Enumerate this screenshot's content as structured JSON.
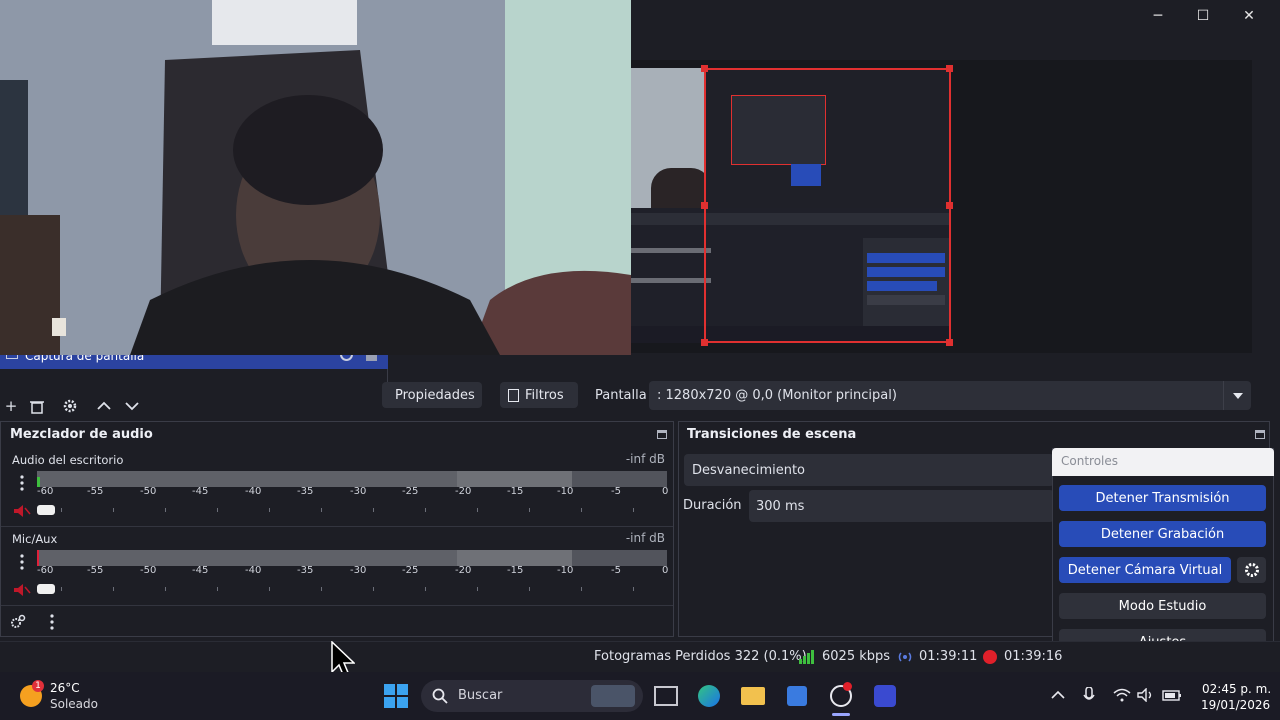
{
  "window": {
    "minimize_glyph": "─",
    "maximize_glyph": "☐",
    "close_glyph": "✕"
  },
  "sources": {
    "selected_item": "Captura de pantalla"
  },
  "properties_bar": {
    "properties_label": "Propiedades",
    "filters_label": "Filtros",
    "display_label": "Pantalla",
    "display_value": ": 1280x720 @ 0,0 (Monitor principal)"
  },
  "audio_mixer": {
    "title": "Mezclador de audio",
    "scale": [
      "-60",
      "-55",
      "-50",
      "-45",
      "-40",
      "-35",
      "-30",
      "-25",
      "-20",
      "-15",
      "-10",
      "-5",
      "0"
    ],
    "channels": [
      {
        "name": "Audio del escritorio",
        "level": "-inf dB"
      },
      {
        "name": "Mic/Aux",
        "level": "-inf dB"
      }
    ]
  },
  "transitions": {
    "title": "Transiciones de escena",
    "selected": "Desvanecimiento",
    "duration_label": "Duración",
    "duration_value": "300 ms"
  },
  "controls": {
    "title": "Controles",
    "stop_stream": "Detener Transmisión",
    "stop_record": "Detener Grabación",
    "stop_virtual_cam": "Detener Cámara Virtual",
    "studio_mode": "Modo Estudio",
    "settings": "Ajustes"
  },
  "status": {
    "dropped_frames": "Fotogramas Perdidos 322 (0.1%)",
    "bitrate": "6025 kbps",
    "stream_time": "01:39:11",
    "record_time": "01:39:16"
  },
  "taskbar": {
    "weather_temp": "26°C",
    "weather_desc": "Soleado",
    "weather_badge": "1",
    "search_label": "Buscar",
    "time": "02:45 p. m.",
    "date": "19/01/2026"
  },
  "colors": {
    "accent": "#284cb8",
    "record": "#e0202a",
    "selection": "#e03030"
  }
}
